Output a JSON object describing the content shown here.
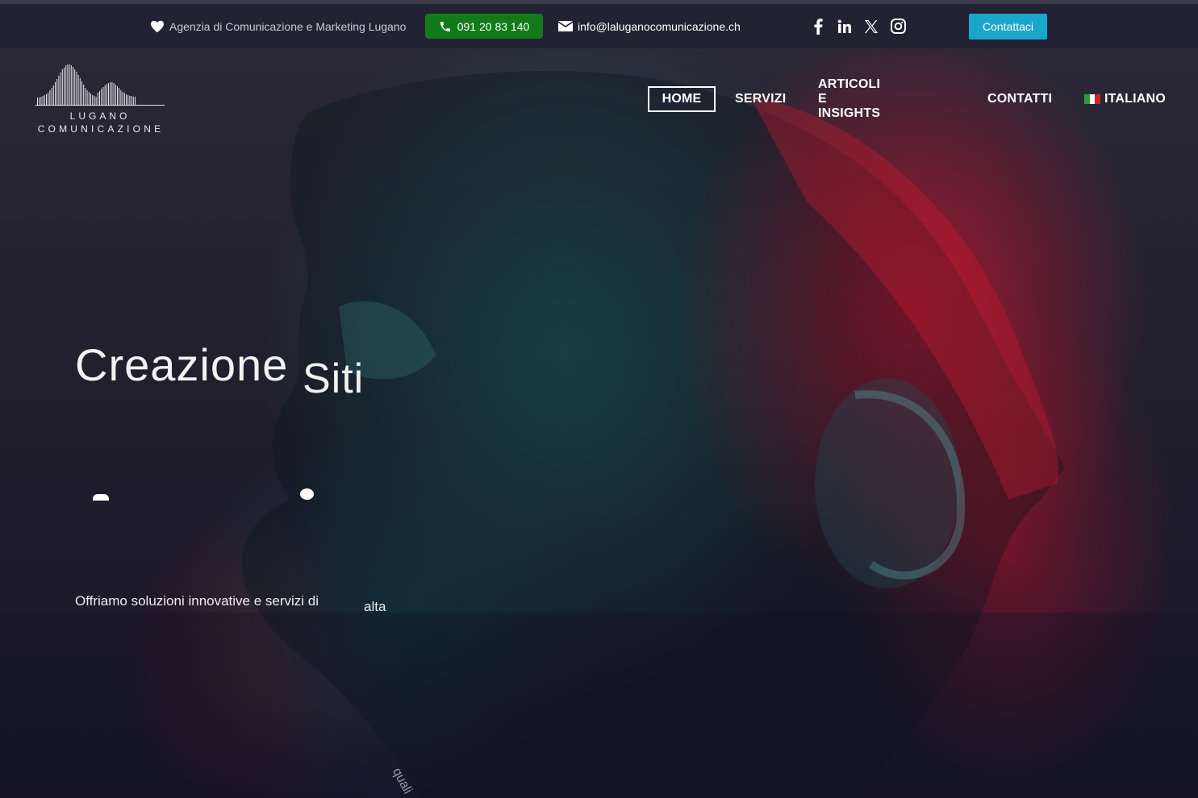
{
  "topbar": {
    "tagline": "Agenzia di Comunicazione e Marketing Lugano",
    "phone": "091 20 83 140",
    "email": "info@laluganocomunicazione.ch",
    "social": [
      "facebook-icon",
      "linkedin-icon",
      "x-icon",
      "instagram-icon"
    ],
    "contact_label": "Contattaci"
  },
  "logo": {
    "line1": "LUGANO",
    "line2": "COMUNICAZIONE"
  },
  "nav": {
    "home": "HOME",
    "servizi": "SERVIZI",
    "articoli": "ARTICOLI E INSIGHTS",
    "contatti": "CONTATTI",
    "lingua": "ITALIANO"
  },
  "hero": {
    "word1": "Creazione",
    "word2": "Siti",
    "subtitle_part1": "Offriamo soluzioni innovative e servizi di",
    "subtitle_part2": "alta",
    "rotated_fragment": "quali"
  },
  "colors": {
    "topbar_bg": "#232233",
    "phone_green": "#127a1a",
    "contact_blue": "#1aa6c9",
    "flag": [
      "#2e9b3a",
      "#ffffff",
      "#d2232a"
    ]
  }
}
